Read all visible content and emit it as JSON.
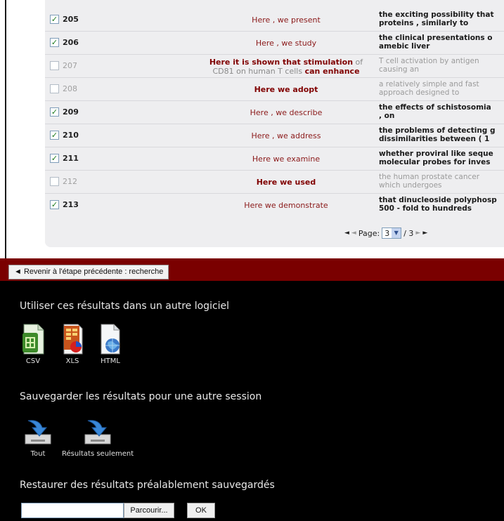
{
  "rows": [
    {
      "checked": true,
      "num": "205",
      "phrase": "Here , we present",
      "ctx1": "the exciting possibility that",
      "ctx2": "proteins , similarly to"
    },
    {
      "checked": true,
      "num": "206",
      "phrase": "Here , we study",
      "ctx1": "the clinical presentations o",
      "ctx2": "amebic liver"
    },
    {
      "checked": false,
      "num": "207",
      "phrase1_bold": "Here it is shown that stimulation",
      "phrase1_dim": " of",
      "phrase2_dim": "CD81 on human T cells ",
      "phrase2_bold": "can enhance",
      "ctx1": "T cell activation by antigen",
      "ctx2": "causing an"
    },
    {
      "checked": false,
      "num": "208",
      "phrase": "Here we adopt",
      "ctx1": "a relatively simple and fast",
      "ctx2": "approach designed to"
    },
    {
      "checked": true,
      "num": "209",
      "phrase": "Here , we describe",
      "ctx1": "the effects of schistosomia",
      "ctx2": ", on"
    },
    {
      "checked": true,
      "num": "210",
      "phrase": "Here , we address",
      "ctx1": "the problems of detecting g",
      "ctx2": "dissimilarities between ( 1"
    },
    {
      "checked": true,
      "num": "211",
      "phrase": "Here we examine",
      "ctx1": "whether proviral like seque",
      "ctx2": "molecular probes for inves"
    },
    {
      "checked": false,
      "num": "212",
      "phrase": "Here we used",
      "ctx1": "the human prostate cancer",
      "ctx2": "which undergoes"
    },
    {
      "checked": true,
      "num": "213",
      "phrase": "Here we demonstrate",
      "ctx1": "that dinucleoside polyphosp",
      "ctx2": "500 - fold to hundreds"
    }
  ],
  "pager": {
    "label": "Page:",
    "current": "3",
    "total": "/ 3"
  },
  "back_button": "Revenir à l'étape précédente : recherche",
  "export": {
    "title": "Utiliser ces résultats dans un autre logiciel",
    "csv": "CSV",
    "xls": "XLS",
    "html": "HTML"
  },
  "save": {
    "title": "Sauvegarder les résultats pour une autre session",
    "all": "Tout",
    "results_only": "Résultats seulement"
  },
  "restore": {
    "title": "Restaurer des résultats préalablement sauvegardés",
    "browse": "Parcourir...",
    "ok": "OK"
  },
  "icons": {
    "checkmark": "✓",
    "prev_arrow": "◄",
    "next_arrow": "►",
    "dropdown_arrow": "▼"
  }
}
